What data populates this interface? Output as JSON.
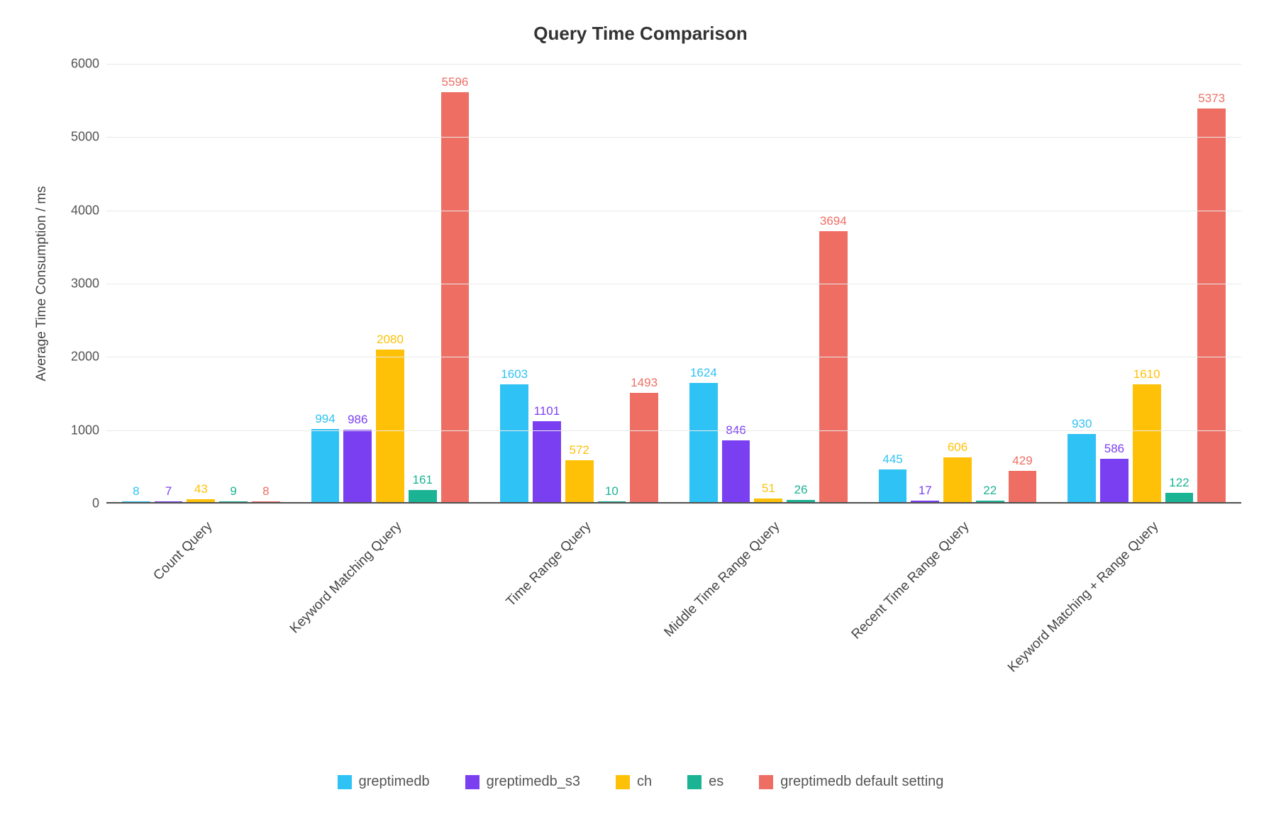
{
  "chart_data": {
    "type": "bar",
    "title": "Query Time Comparison",
    "ylabel": "Average Time Consumption / ms",
    "xlabel": "",
    "ylim": [
      0,
      6000
    ],
    "yticks": [
      0,
      1000,
      2000,
      3000,
      4000,
      5000,
      6000
    ],
    "categories": [
      "Count Query",
      "Keyword Matching Query",
      "Time Range Query",
      "Middle Time Range Query",
      "Recent Time Range Query",
      "Keyword Matching + Range Query"
    ],
    "series": [
      {
        "name": "greptimedb",
        "color": "#2fc2f4",
        "values": [
          8,
          994,
          1603,
          1624,
          445,
          930
        ]
      },
      {
        "name": "greptimedb_s3",
        "color": "#7b3ff2",
        "values": [
          7,
          986,
          1101,
          846,
          17,
          586
        ]
      },
      {
        "name": "ch",
        "color": "#ffc107",
        "values": [
          43,
          2080,
          572,
          51,
          606,
          1610
        ]
      },
      {
        "name": "es",
        "color": "#1ab394",
        "values": [
          9,
          161,
          10,
          26,
          22,
          122
        ]
      },
      {
        "name": "greptimedb default setting",
        "color": "#ef6e64",
        "values": [
          8,
          5596,
          1493,
          3694,
          429,
          5373
        ]
      }
    ]
  }
}
